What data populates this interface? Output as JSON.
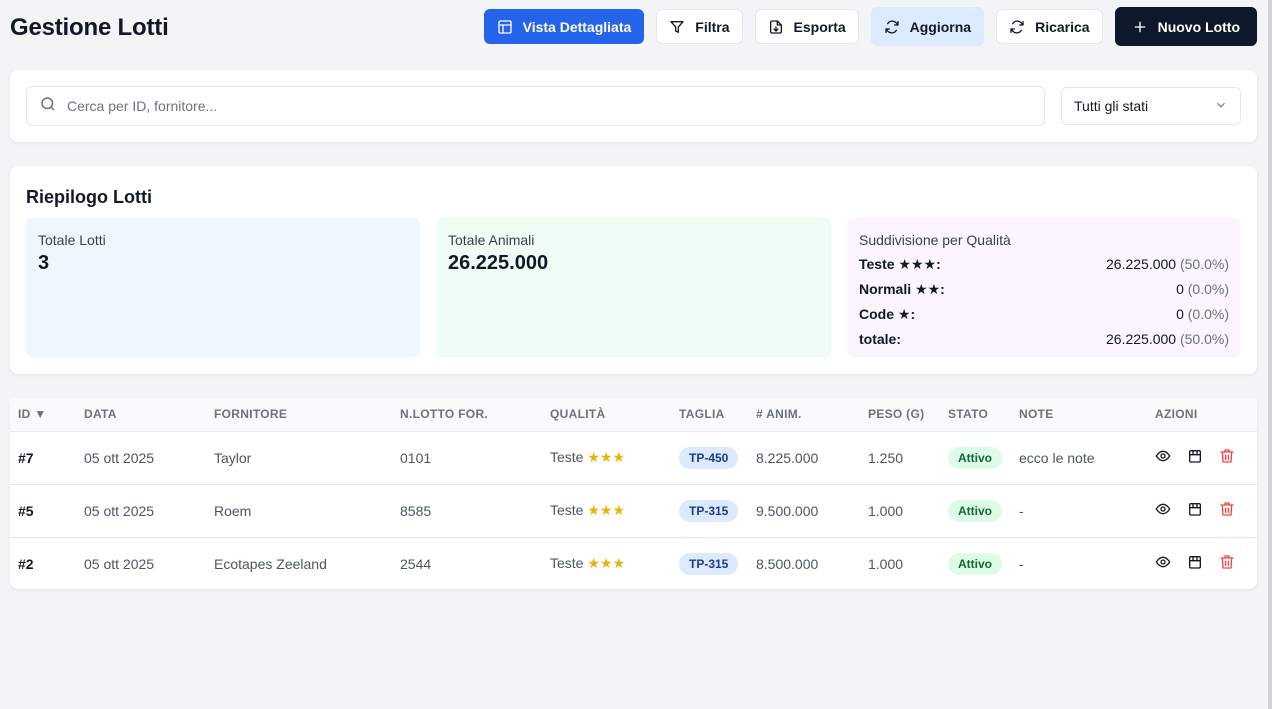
{
  "header": {
    "title": "Gestione Lotti",
    "buttons": {
      "detailed_view": "Vista Dettagliata",
      "filter": "Filtra",
      "export": "Esporta",
      "update": "Aggiorna",
      "reload": "Ricarica",
      "new_lot": "Nuovo Lotto"
    }
  },
  "search": {
    "placeholder": "Cerca per ID, fornitore...",
    "value": "",
    "status_filter": "Tutti gli stati"
  },
  "summary": {
    "title": "Riepilogo Lotti",
    "total_lots_label": "Totale Lotti",
    "total_lots_value": "3",
    "total_animals_label": "Totale Animali",
    "total_animals_value": "26.225.000",
    "quality_label": "Suddivisione per Qualità",
    "quality_rows": [
      {
        "label": "Teste ★★★:",
        "value": "26.225.000",
        "pct": "(50.0%)"
      },
      {
        "label": "Normali ★★:",
        "value": "0",
        "pct": "(0.0%)"
      },
      {
        "label": "Code ★:",
        "value": "0",
        "pct": "(0.0%)"
      },
      {
        "label": "totale:",
        "value": "26.225.000",
        "pct": "(50.0%)"
      }
    ]
  },
  "table": {
    "headers": {
      "id": "ID ▼",
      "date": "DATA",
      "supplier": "FORNITORE",
      "supplier_lot": "N.LOTTO FOR.",
      "quality": "QUALITÀ",
      "size": "TAGLIA",
      "animals": "# ANIM.",
      "weight": "PESO (G)",
      "status": "STATO",
      "notes": "NOTE",
      "actions": "AZIONI"
    },
    "rows": [
      {
        "id": "#7",
        "date": "05 ott 2025",
        "supplier": "Taylor",
        "supplier_lot": "0101",
        "quality": "Teste",
        "stars": "★★★",
        "size": "TP-450",
        "animals": "8.225.000",
        "weight": "1.250",
        "status": "Attivo",
        "notes": "ecco le note"
      },
      {
        "id": "#5",
        "date": "05 ott 2025",
        "supplier": "Roem",
        "supplier_lot": "8585",
        "quality": "Teste",
        "stars": "★★★",
        "size": "TP-315",
        "animals": "9.500.000",
        "weight": "1.000",
        "status": "Attivo",
        "notes": "-"
      },
      {
        "id": "#2",
        "date": "05 ott 2025",
        "supplier": "Ecotapes Zeeland",
        "supplier_lot": "2544",
        "quality": "Teste",
        "stars": "★★★",
        "size": "TP-315",
        "animals": "8.500.000",
        "weight": "1.000",
        "status": "Attivo",
        "notes": "-"
      }
    ]
  }
}
